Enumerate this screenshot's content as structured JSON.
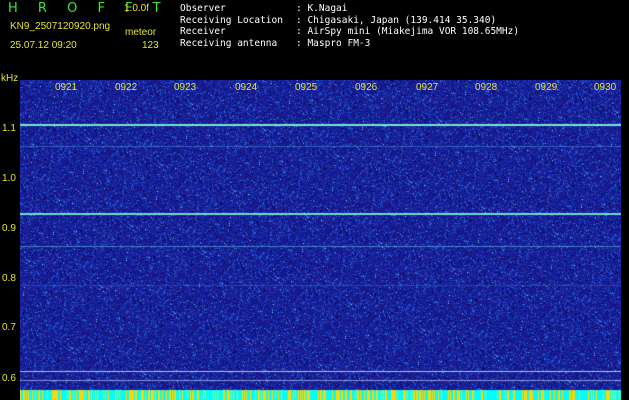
{
  "header": {
    "title": "H R O F F T",
    "version": "1.0.0f",
    "filename": "KN9_2507120920.png",
    "mode": "meteor",
    "datetime": "25.07.12 09:20",
    "count": "123"
  },
  "info": [
    {
      "label": "Observer",
      "value": ": K.Nagai"
    },
    {
      "label": "Receiving Location",
      "value": ": Chigasaki, Japan (139.414 35.340)"
    },
    {
      "label": "Receiver",
      "value": ": AirSpy mini (Miakejima VOR 108.65MHz)"
    },
    {
      "label": "Receiving antenna",
      "value": ": Maspro FM-3"
    }
  ],
  "axis": {
    "unit": "kHz",
    "time_labels": [
      "0921",
      "0922",
      "0923",
      "0924",
      "0925",
      "0926",
      "0927",
      "0928",
      "0929",
      "0930"
    ],
    "freq_labels": [
      "1.1",
      "1.0",
      "0.9",
      "0.8",
      "0.7",
      "0.6"
    ]
  },
  "colors": {
    "background": "#1a1a8c",
    "axis_text": "#e6e62e",
    "title": "#39e639",
    "signal": "#7fffd4",
    "baseline": "#00ffff"
  }
}
